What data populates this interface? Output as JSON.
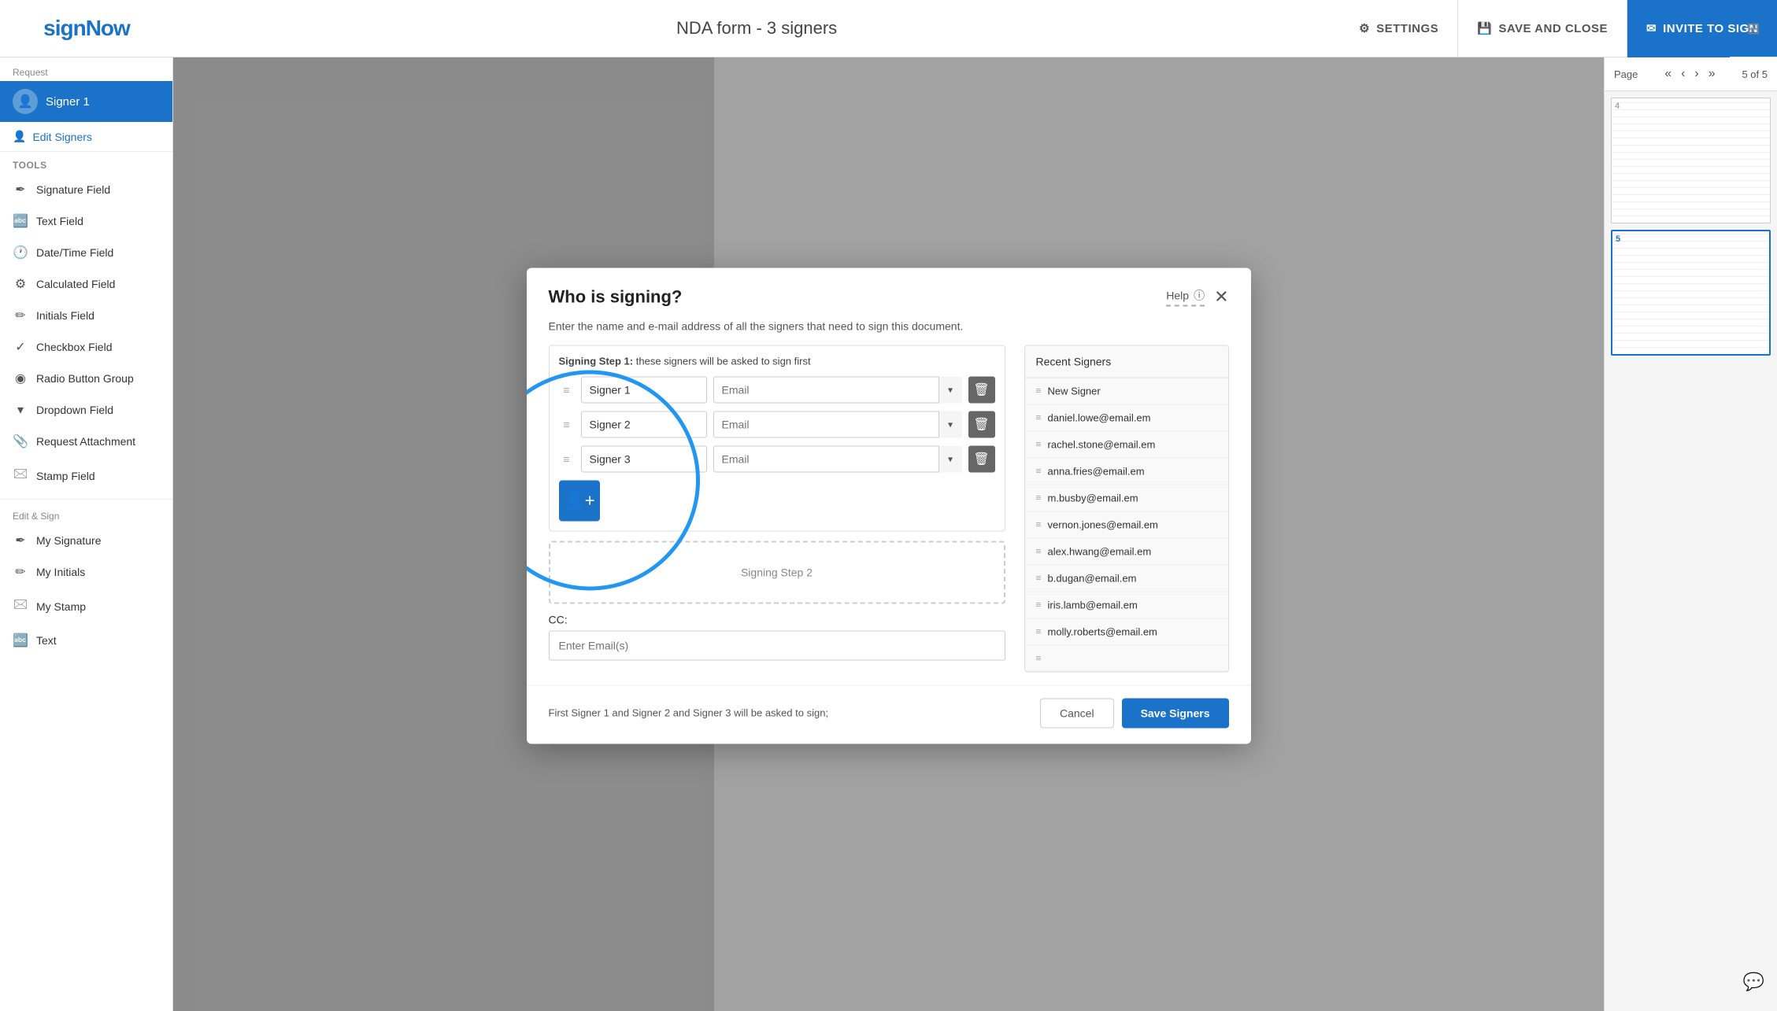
{
  "topbar": {
    "logo": "signNow",
    "title": "NDA form - 3 signers",
    "settings_label": "SETTINGS",
    "save_label": "SAVE AND CLOSE",
    "invite_label": "INVITE TO SIGN"
  },
  "sidebar": {
    "section_request": "Request",
    "signer1_label": "Signer 1",
    "edit_signers": "Edit Signers",
    "tools_label": "Tools",
    "tools": [
      {
        "icon": "✒",
        "label": "Signature Field"
      },
      {
        "icon": "🔤",
        "label": "Text Field"
      },
      {
        "icon": "🕐",
        "label": "Date/Time Field"
      },
      {
        "icon": "⚙",
        "label": "Calculated Field"
      },
      {
        "icon": "✏",
        "label": "Initials Field"
      },
      {
        "icon": "✓",
        "label": "Checkbox Field"
      },
      {
        "icon": "◉",
        "label": "Radio Button Group"
      },
      {
        "icon": "▾",
        "label": "Dropdown Field"
      },
      {
        "icon": "📎",
        "label": "Request Attachment"
      },
      {
        "icon": "🖂",
        "label": "Stamp Field"
      }
    ],
    "edit_sign_label": "Edit & Sign",
    "edit_sign_tools": [
      {
        "icon": "✒",
        "label": "My Signature"
      },
      {
        "icon": "✏",
        "label": "My Initials"
      },
      {
        "icon": "🖂",
        "label": "My Stamp"
      },
      {
        "icon": "🔤",
        "label": "Text"
      }
    ]
  },
  "modal": {
    "title": "Who is signing?",
    "help_label": "Help",
    "subtitle": "Enter the name and e-mail address of all the signers that need to sign this document.",
    "signing_step1_label": "Signing Step 1:",
    "signing_step1_desc": "these signers will be asked to sign first",
    "signers": [
      {
        "name": "Signer 1",
        "email_placeholder": "Email"
      },
      {
        "name": "Signer 2",
        "email_placeholder": "Email"
      },
      {
        "name": "Signer 3",
        "email_placeholder": "Email"
      }
    ],
    "signing_step2_label": "Signing Step 2",
    "cc_label": "CC:",
    "cc_placeholder": "Enter Email(s)",
    "footer_info": "First Signer 1 and Signer 2 and Signer 3 will be asked to sign;",
    "cancel_label": "Cancel",
    "save_signers_label": "Save Signers"
  },
  "recent_signers": {
    "title": "Recent Signers",
    "items": [
      {
        "label": "New Signer"
      },
      {
        "label": "daniel.lowe@email.em"
      },
      {
        "label": "rachel.stone@email.em"
      },
      {
        "label": "anna.fries@email.em"
      },
      {
        "label": "m.busby@email.em"
      },
      {
        "label": "vernon.jones@email.em"
      },
      {
        "label": "alex.hwang@email.em"
      },
      {
        "label": "b.dugan@email.em"
      },
      {
        "label": "iris.lamb@email.em"
      },
      {
        "label": "molly.roberts@email.em"
      },
      {
        "label": ""
      }
    ]
  },
  "page_nav": {
    "label": "Page",
    "current": "5 of 5"
  }
}
